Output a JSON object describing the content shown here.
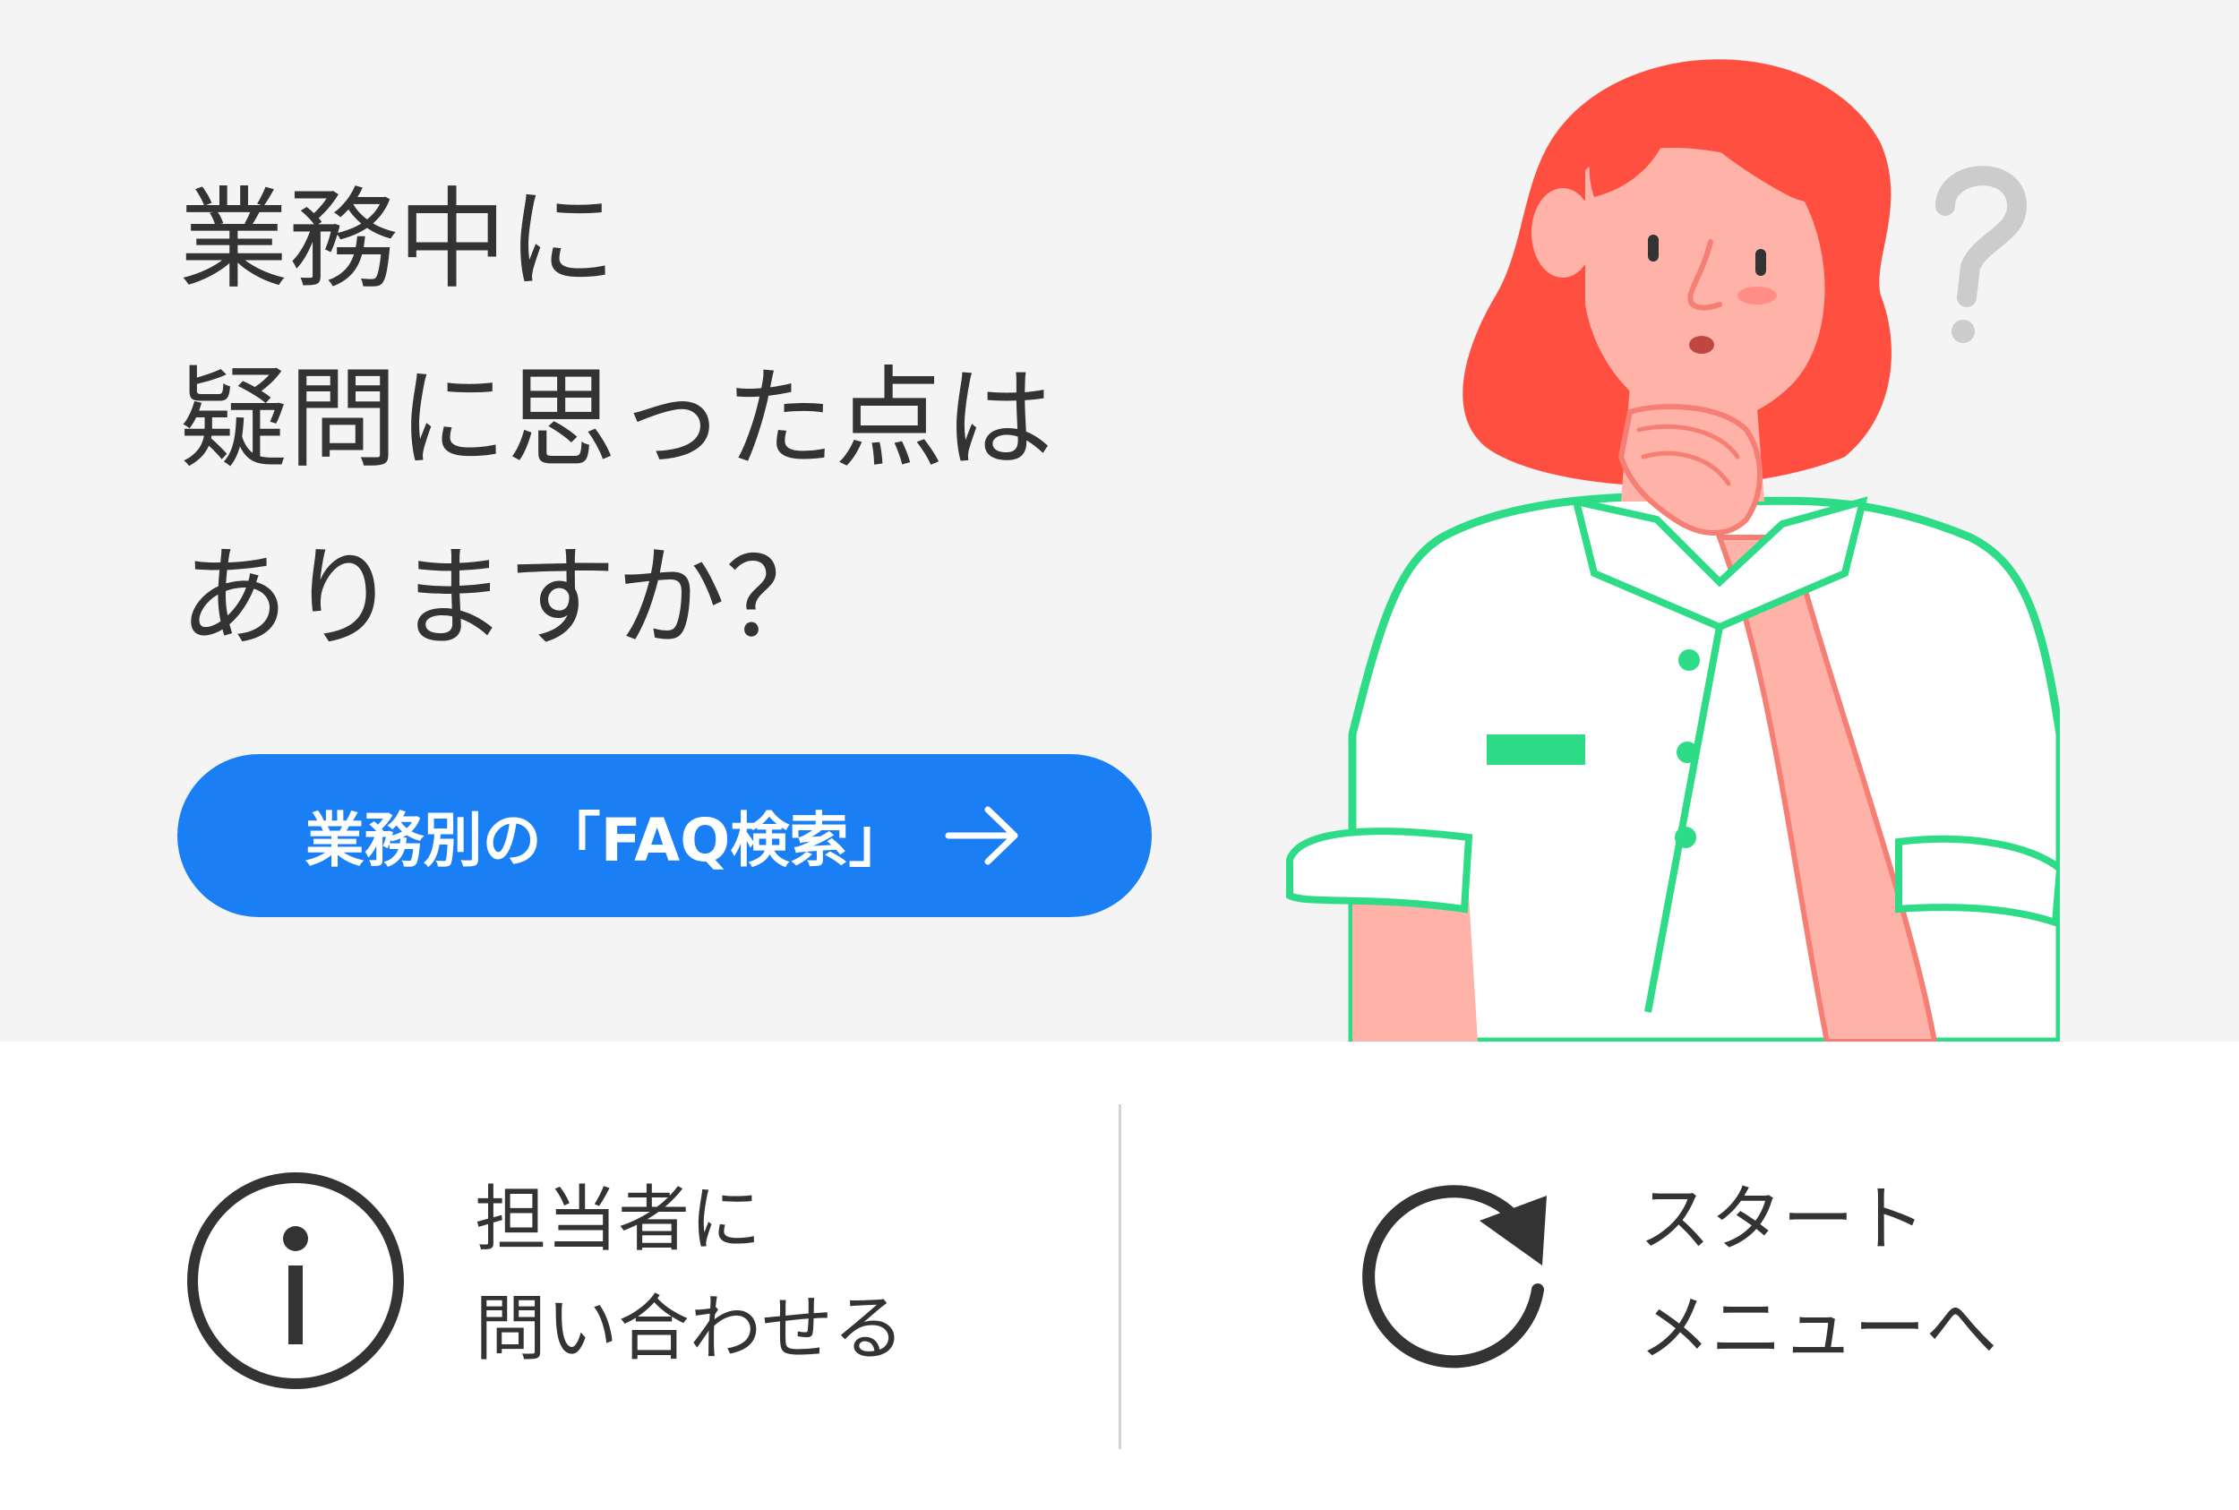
{
  "hero": {
    "headline": [
      "業務中に",
      "疑問に思った点は",
      "ありますか？"
    ],
    "faq_button_label": "業務別の「FAQ検索」"
  },
  "actions": {
    "contact": {
      "label": [
        "担当者に",
        "問い合わせる"
      ],
      "icon": "info-icon"
    },
    "start_menu": {
      "label": [
        "スタート",
        "メニューへ"
      ],
      "icon": "refresh-icon"
    }
  },
  "colors": {
    "accent": "#1a7ff5",
    "hair": "#ff4f40",
    "skin": "#ffb3a8",
    "uniform_trim": "#2edc88",
    "hero_bg": "#f4f4f4",
    "text": "#333333"
  }
}
